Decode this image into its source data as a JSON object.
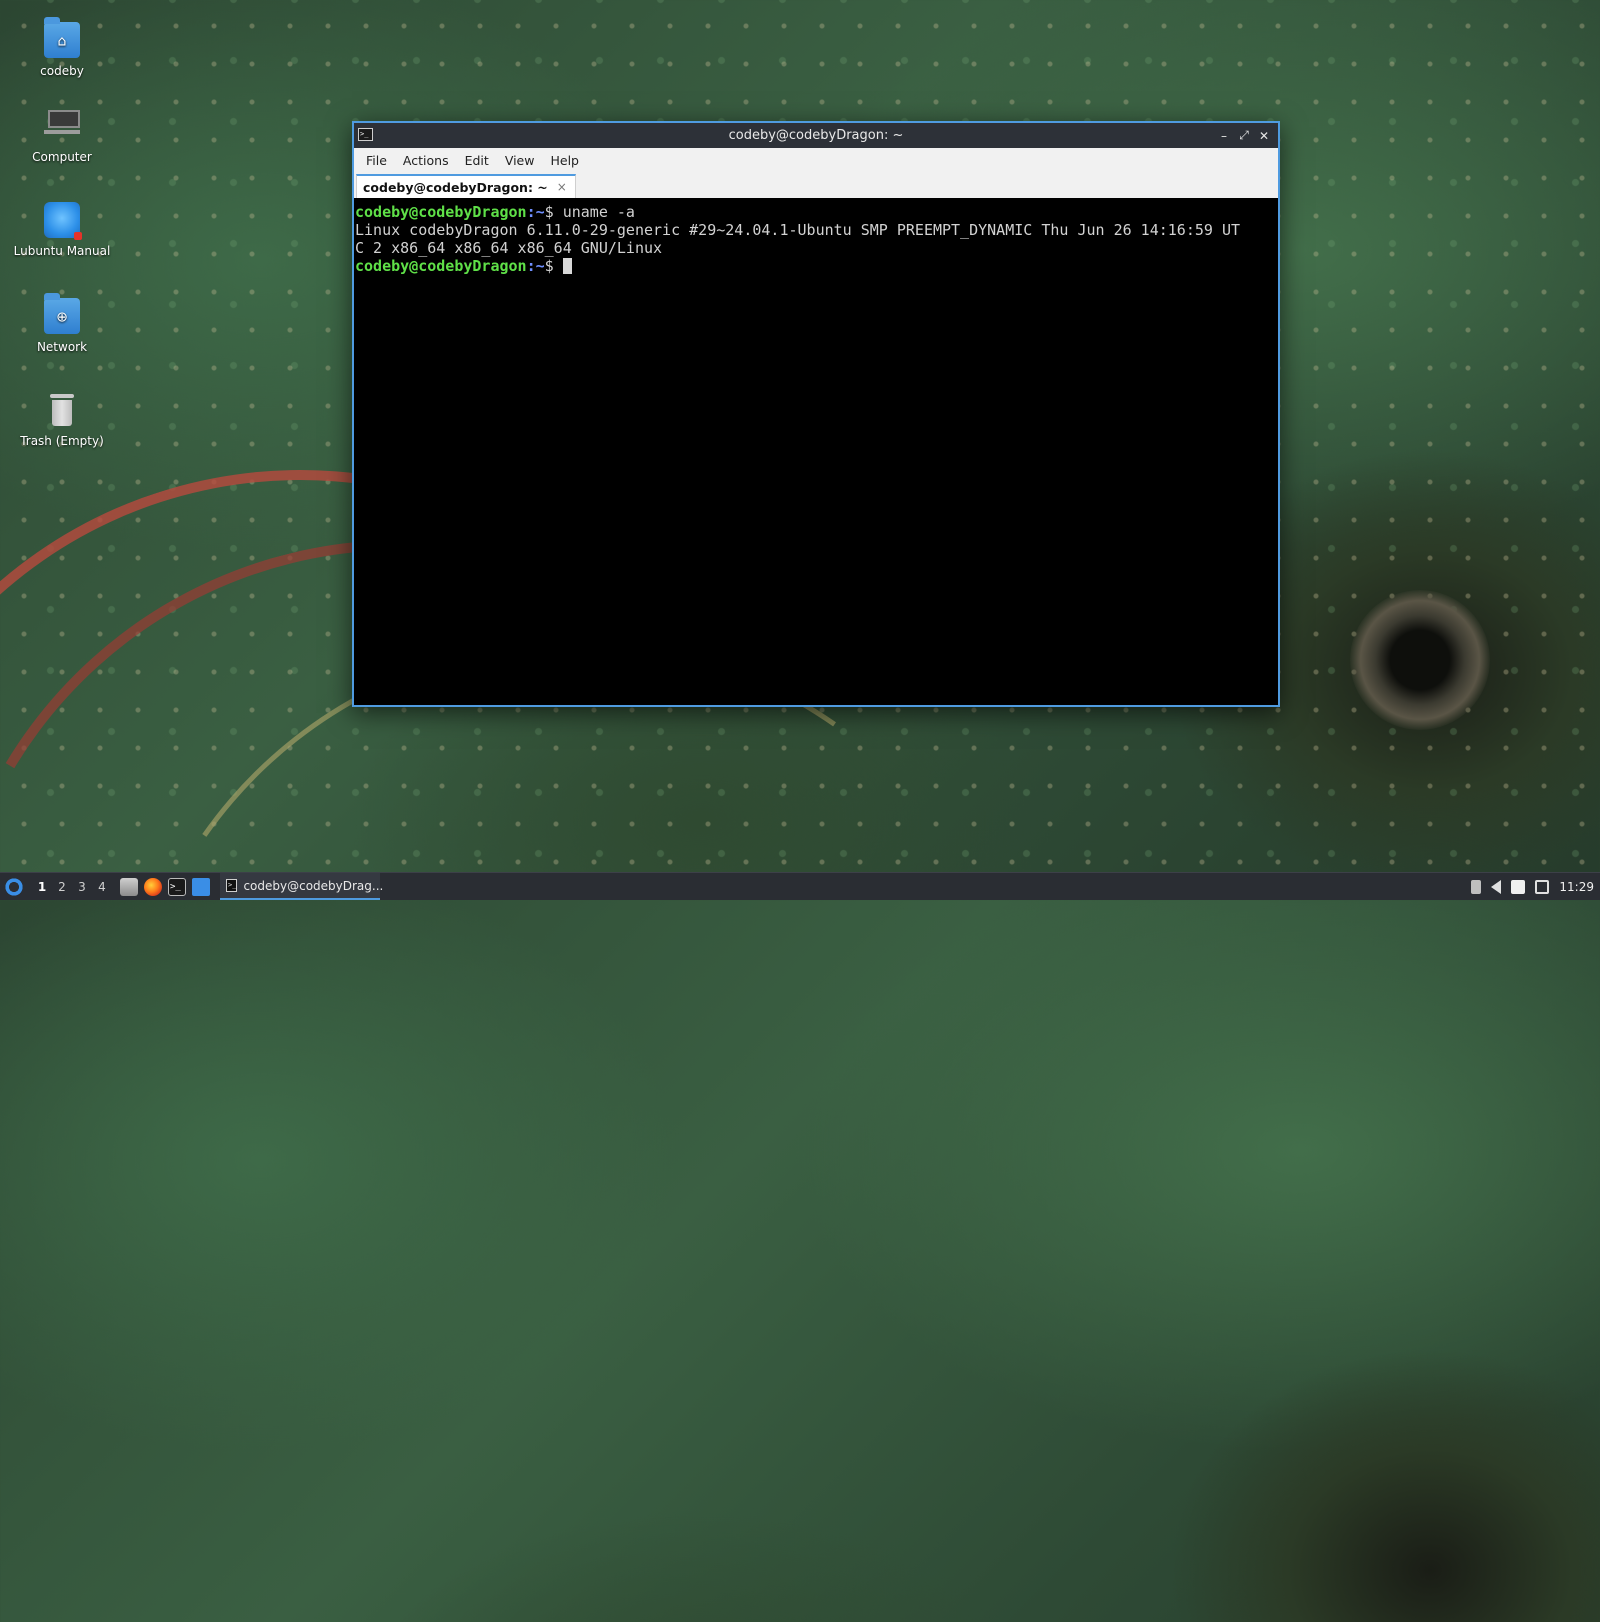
{
  "desktop": {
    "icons": [
      {
        "label": "codeby",
        "icon": "home-folder-icon"
      },
      {
        "label": "Computer",
        "icon": "computer-icon"
      },
      {
        "label": "Lubuntu Manual",
        "icon": "manual-icon"
      },
      {
        "label": "Network",
        "icon": "network-folder-icon"
      },
      {
        "label": "Trash (Empty)",
        "icon": "trash-icon"
      }
    ]
  },
  "window": {
    "title": "codeby@codebyDragon: ~",
    "controls": {
      "minimize": "–",
      "maximize": "⤢",
      "close": "✕"
    },
    "menu": [
      "File",
      "Actions",
      "Edit",
      "View",
      "Help"
    ],
    "tab": {
      "label": "codeby@codebyDragon: ~",
      "close": "×"
    }
  },
  "terminal": {
    "prompt_user": "codeby@codebyDragon",
    "prompt_path": ":~",
    "prompt_symbol": "$ ",
    "command": "uname -a",
    "output_1": "Linux codebyDragon 6.11.0-29-generic #29~24.04.1-Ubuntu SMP PREEMPT_DYNAMIC Thu Jun 26 14:16:59 UT",
    "output_2": "C 2 x86_64 x86_64 x86_64 GNU/Linux"
  },
  "taskbar": {
    "desktops": [
      "1",
      "2",
      "3",
      "4"
    ],
    "active_task": "codeby@codebyDrag...",
    "clock": "11:29"
  },
  "colors": {
    "accent": "#4f9be0",
    "prompt_user": "#5fe048",
    "prompt_path": "#6f8fff"
  }
}
